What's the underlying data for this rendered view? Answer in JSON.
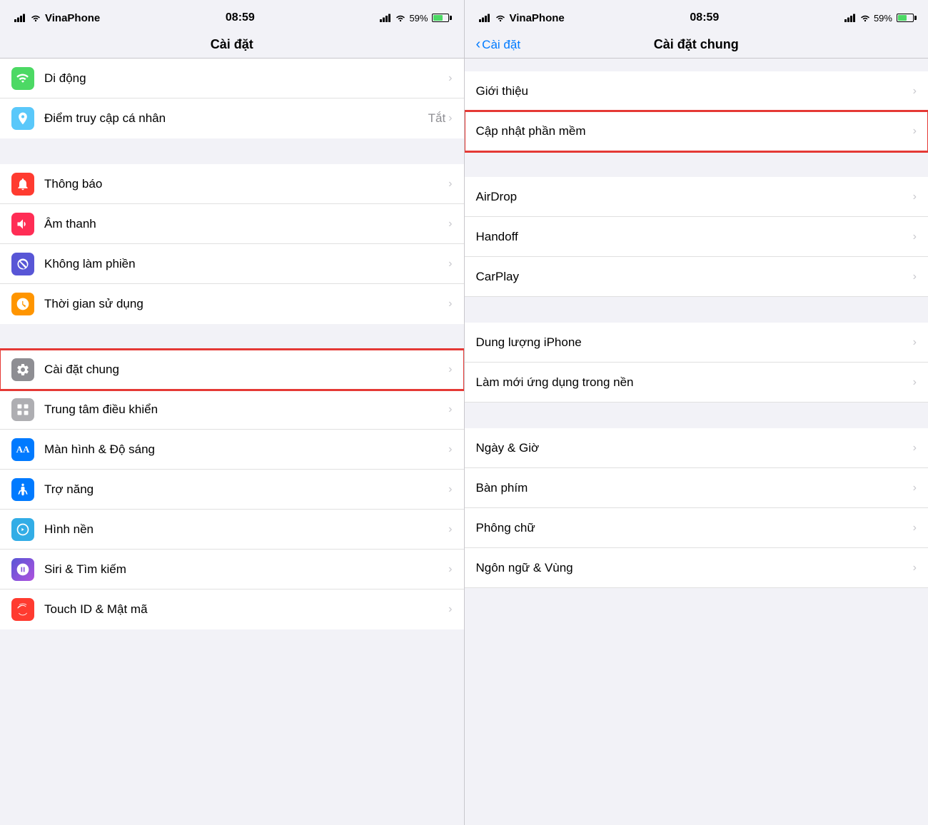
{
  "left_panel": {
    "status_bar": {
      "carrier": "VinaPhone",
      "time": "08:59",
      "battery": "59%",
      "charging": true
    },
    "nav": {
      "title": "Cài đặt"
    },
    "sections": [
      {
        "items": [
          {
            "id": "di-dong",
            "icon": "📶",
            "icon_bg": "icon-green",
            "label": "Di động",
            "value": "",
            "chevron": true
          },
          {
            "id": "diem-truy-cap",
            "icon": "🔄",
            "icon_bg": "icon-teal",
            "label": "Điểm truy cập cá nhân",
            "value": "Tắt",
            "chevron": true
          }
        ]
      },
      {
        "items": [
          {
            "id": "thong-bao",
            "icon": "🔔",
            "icon_bg": "icon-red",
            "label": "Thông báo",
            "value": "",
            "chevron": true
          },
          {
            "id": "am-thanh",
            "icon": "🔊",
            "icon_bg": "icon-pink",
            "label": "Âm thanh",
            "value": "",
            "chevron": true
          },
          {
            "id": "khong-lam-phien",
            "icon": "🌙",
            "icon_bg": "icon-indigo",
            "label": "Không làm phiền",
            "value": "",
            "chevron": true
          },
          {
            "id": "thoi-gian-su-dung",
            "icon": "⏳",
            "icon_bg": "icon-orange",
            "label": "Thời gian sử dụng",
            "value": "",
            "chevron": true
          }
        ]
      },
      {
        "items": [
          {
            "id": "cai-dat-chung",
            "icon": "⚙️",
            "icon_bg": "icon-gray",
            "label": "Cài đặt chung",
            "value": "",
            "chevron": true,
            "highlighted": true
          },
          {
            "id": "trung-tam-dieu-khien",
            "icon": "🎛",
            "icon_bg": "icon-light-gray",
            "label": "Trung tâm điều khiển",
            "value": "",
            "chevron": true
          },
          {
            "id": "man-hinh-do-sang",
            "icon": "AA",
            "icon_bg": "icon-blue",
            "label": "Màn hình & Độ sáng",
            "value": "",
            "chevron": true
          },
          {
            "id": "tro-nang",
            "icon": "♿",
            "icon_bg": "icon-blue",
            "label": "Trợ năng",
            "value": "",
            "chevron": true
          },
          {
            "id": "hinh-nen",
            "icon": "🌸",
            "icon_bg": "icon-cyan",
            "label": "Hình nền",
            "value": "",
            "chevron": true
          },
          {
            "id": "siri-tim-kiem",
            "icon": "🔮",
            "icon_bg": "icon-purple",
            "label": "Siri & Tìm kiếm",
            "value": "",
            "chevron": true
          },
          {
            "id": "touch-id",
            "icon": "👆",
            "icon_bg": "icon-red",
            "label": "Touch ID & Mật mã",
            "value": "",
            "chevron": true
          }
        ]
      }
    ]
  },
  "right_panel": {
    "status_bar": {
      "carrier": "VinaPhone",
      "time": "08:59",
      "battery": "59%",
      "charging": true
    },
    "nav": {
      "back_label": "Cài đặt",
      "title": "Cài đặt chung"
    },
    "sections": [
      {
        "items": [
          {
            "id": "gioi-thieu",
            "label": "Giới thiệu",
            "chevron": true
          },
          {
            "id": "cap-nhat-phan-mem",
            "label": "Cập nhật phần mềm",
            "chevron": true,
            "highlighted": true
          }
        ]
      },
      {
        "items": [
          {
            "id": "airdrop",
            "label": "AirDrop",
            "chevron": true
          },
          {
            "id": "handoff",
            "label": "Handoff",
            "chevron": true
          },
          {
            "id": "carplay",
            "label": "CarPlay",
            "chevron": true
          }
        ]
      },
      {
        "items": [
          {
            "id": "dung-luong-iphone",
            "label": "Dung lượng iPhone",
            "chevron": true
          },
          {
            "id": "lam-moi-ung-dung",
            "label": "Làm mới ứng dụng trong nền",
            "chevron": true
          }
        ]
      },
      {
        "items": [
          {
            "id": "ngay-gio",
            "label": "Ngày & Giờ",
            "chevron": true
          },
          {
            "id": "ban-phim",
            "label": "Bàn phím",
            "chevron": true
          },
          {
            "id": "phong-chu",
            "label": "Phông chữ",
            "chevron": true
          },
          {
            "id": "ngon-ngu-vung",
            "label": "Ngôn ngữ & Vùng",
            "chevron": true
          }
        ]
      }
    ],
    "icons": {
      "search": "🔍",
      "gear": "⚙️"
    }
  }
}
